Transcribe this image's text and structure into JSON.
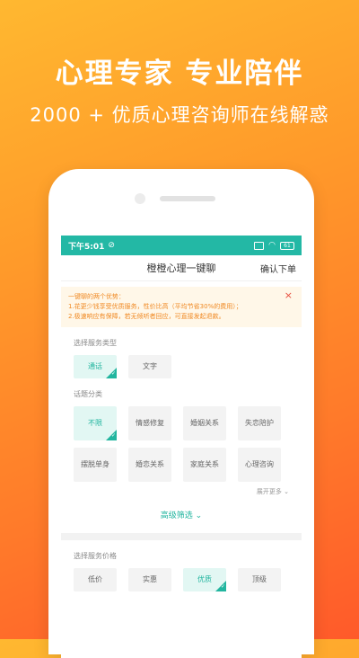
{
  "hero": {
    "title": "心理专家 专业陪伴",
    "subtitle": "2000 + 优质心理咨询师在线解惑"
  },
  "statusbar": {
    "time": "下午5:01",
    "battery": "61"
  },
  "navbar": {
    "title": "橙橙心理一键聊",
    "confirm": "确认下单"
  },
  "notice": {
    "heading": "一键聊的两个优势：",
    "line1": "1.花更少钱享受优质服务，性价比高（平均节省30%的费用）；",
    "line2": "2.极速响应有保障，若无倾听者回应，可直接发起退款。",
    "close": "×"
  },
  "service_type": {
    "label": "选择服务类型",
    "options": [
      "通话",
      "文字"
    ],
    "selected": "通话"
  },
  "topic": {
    "label": "话题分类",
    "options": [
      "不限",
      "情感修复",
      "婚姻关系",
      "失恋陪护",
      "摆脱单身",
      "婚恋关系",
      "家庭关系",
      "心理咨询"
    ],
    "selected": "不限",
    "more": "展开更多 ⌄"
  },
  "advanced": "高级筛选 ⌄",
  "price": {
    "label": "选择服务价格",
    "options": [
      "低价",
      "实惠",
      "优质",
      "顶级"
    ],
    "selected": "优质"
  }
}
